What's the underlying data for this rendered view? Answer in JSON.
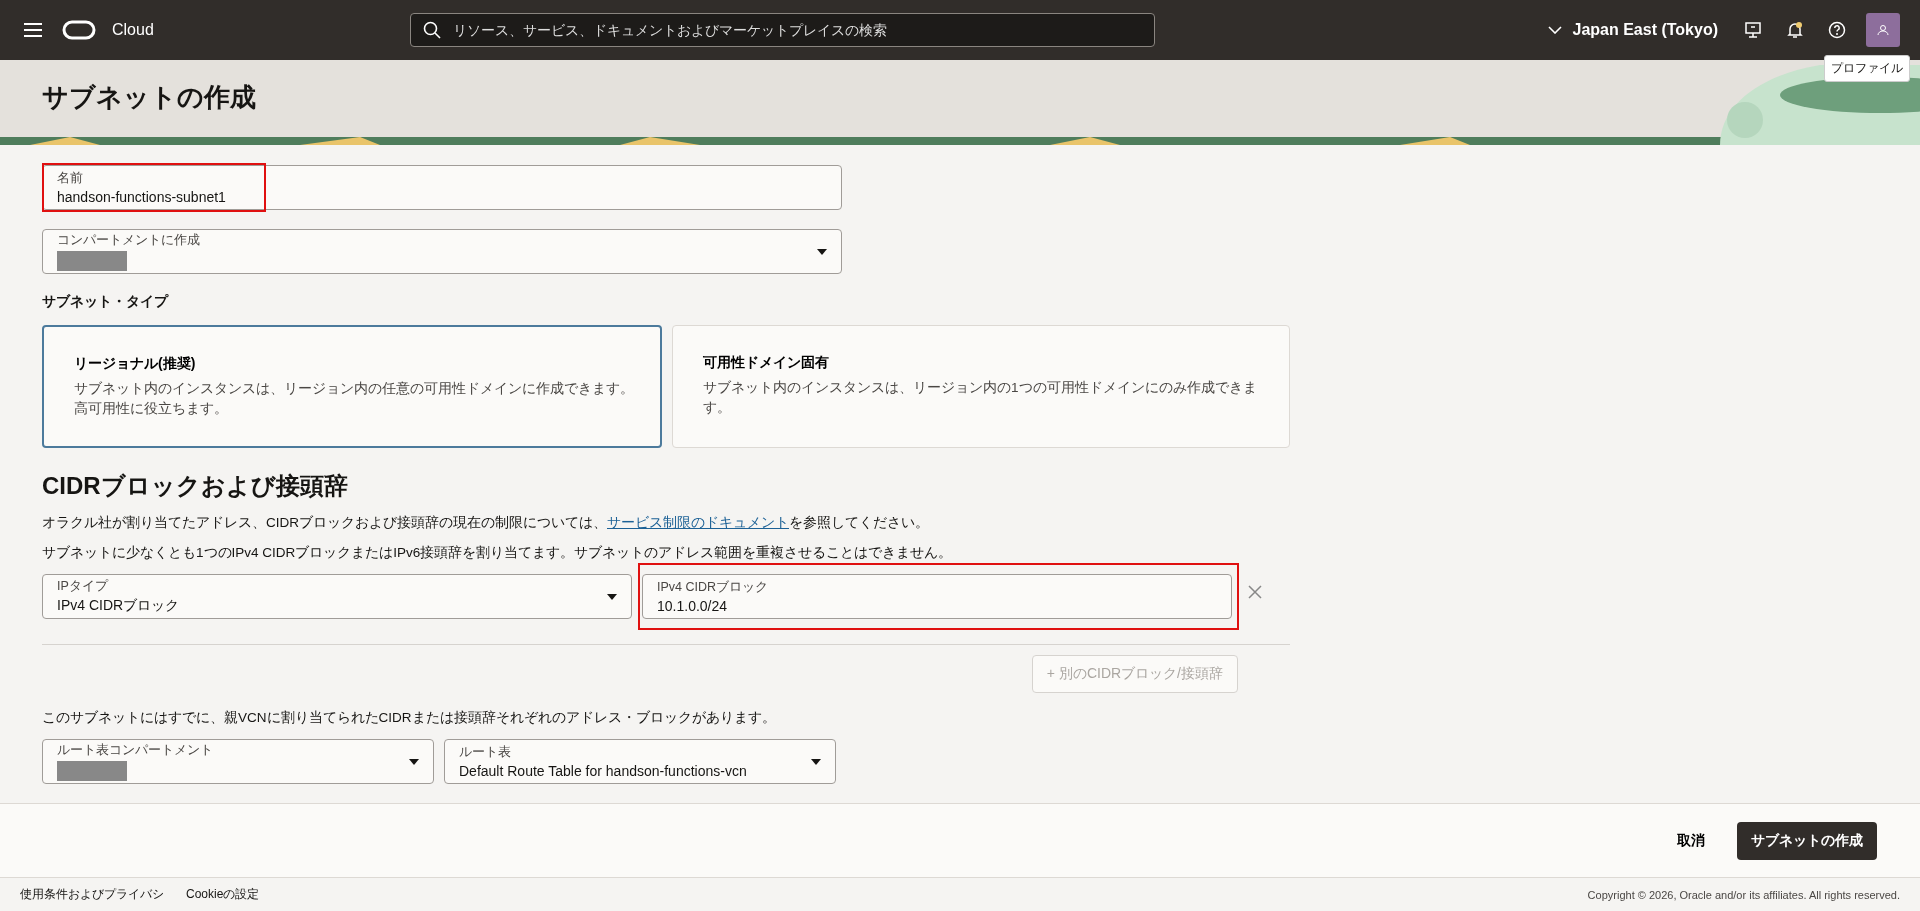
{
  "topbar": {
    "brand": "Cloud",
    "search_placeholder": "リソース、サービス、ドキュメントおよびマーケットプレイスの検索",
    "region": "Japan East (Tokyo)",
    "tooltip": "プロファイル"
  },
  "page_title": "サブネットの作成",
  "name_field": {
    "label": "名前",
    "value": "handson-functions-subnet1",
    "highlighted": true
  },
  "compartment_field": {
    "label": "コンパートメントに作成",
    "redacted": true
  },
  "subnet_type": {
    "label": "サブネット・タイプ",
    "options": [
      {
        "title": "リージョナル(推奨)",
        "description": "サブネット内のインスタンスは、リージョン内の任意の可用性ドメインに作成できます。高可用性に役立ちます。",
        "selected": true
      },
      {
        "title": "可用性ドメイン固有",
        "description": "サブネット内のインスタンスは、リージョン内の1つの可用性ドメインにのみ作成できます。",
        "selected": false
      }
    ]
  },
  "cidr_section": {
    "heading": "CIDRブロックおよび接頭辞",
    "note_before": "オラクル社が割り当てたアドレス、CIDRブロックおよび接頭辞の現在の制限については、",
    "note_link": "サービス制限のドキュメント",
    "note_after": "を参照してください。",
    "instruction": "サブネットに少なくとも1つのIPv4 CIDRブロックまたはIPv6接頭辞を割り当てます。サブネットのアドレス範囲を重複させることはできません。",
    "ip_type_field": {
      "label": "IPタイプ",
      "value": "IPv4 CIDRブロック"
    },
    "cidr_field": {
      "label": "IPv4 CIDRブロック",
      "value": "10.1.0.0/24",
      "highlighted": true
    },
    "add_button": {
      "label": "+ 別のCIDRブロック/接頭辞",
      "disabled": true
    }
  },
  "vcn_note": "このサブネットにはすでに、親VCNに割り当てられたCIDRまたは接頭辞それぞれのアドレス・ブロックがあります。",
  "route_fields": [
    {
      "label": "ルート表コンパートメント",
      "redacted": true
    },
    {
      "label": "ルート表",
      "value": "Default Route Table for handson-functions-vcn",
      "redacted": false
    }
  ],
  "actions": {
    "cancel": "取消",
    "create": "サブネットの作成"
  },
  "footer": {
    "links": [
      "使用条件およびプライバシ",
      "Cookieの設定"
    ],
    "copyright": "Copyright © 2026, Oracle and/or its affiliates. All rights reserved."
  }
}
